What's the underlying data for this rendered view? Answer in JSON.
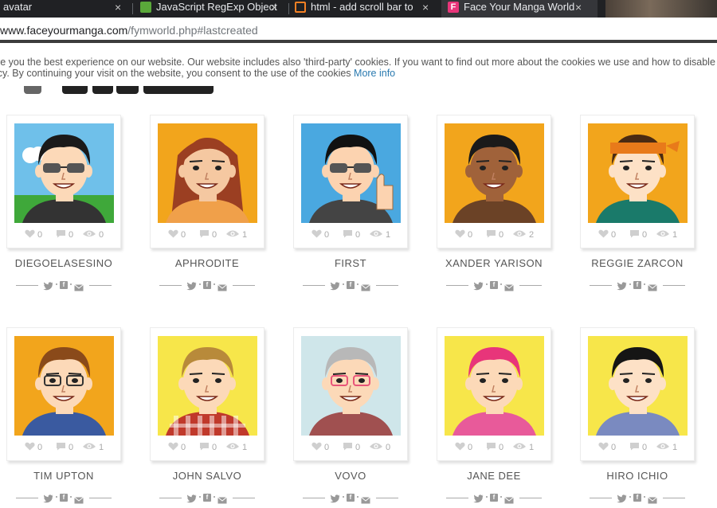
{
  "browser": {
    "tabs": [
      {
        "title": "avatar",
        "close": "×"
      },
      {
        "title": "JavaScript RegExp Object",
        "close": "×"
      },
      {
        "title": "html - add scroll bar to t",
        "close": "×"
      },
      {
        "title": "Face Your Manga World",
        "close": "×"
      }
    ],
    "url": {
      "host": "www.faceyourmanga.com",
      "path": "/fymworld.php#lastcreated"
    }
  },
  "cookie_notice": {
    "line1": "ve you the best experience on our website. Our website includes also 'third-party' cookies. If you want to find out more about the cookies we use and how to disable",
    "line2": "icy. By continuing your visit on the website, you consent to the use of the cookies",
    "link": "More info"
  },
  "cards": [
    {
      "name": "DIEGOELASESINO",
      "likes": "0",
      "comments": "0",
      "views": "0",
      "bg": "#6fc0ea",
      "skin": "#fcd9b8",
      "hair": "#1a1a1a",
      "glasses": "sun",
      "shirt": "#333333",
      "extra": "grass"
    },
    {
      "name": "APHRODITE",
      "likes": "0",
      "comments": "0",
      "views": "1",
      "bg": "#f2a51c",
      "skin": "#f5c8a1",
      "hair": "#9b3f22",
      "glasses": "none",
      "shirt": "#f0a04a",
      "extra": "longhair"
    },
    {
      "name": "FIRST",
      "likes": "0",
      "comments": "0",
      "views": "1",
      "bg": "#4aa8e0",
      "skin": "#fcd3b0",
      "hair": "#111111",
      "glasses": "sun",
      "shirt": "#444444",
      "extra": "thumb"
    },
    {
      "name": "XANDER YARISON",
      "likes": "0",
      "comments": "0",
      "views": "2",
      "bg": "#f2a51c",
      "skin": "#a0623a",
      "hair": "#1a1a1a",
      "glasses": "none",
      "shirt": "#6b4226",
      "extra": "none"
    },
    {
      "name": "REGGIE ZARCON",
      "likes": "0",
      "comments": "0",
      "views": "1",
      "bg": "#f2a51c",
      "skin": "#fde1c6",
      "hair": "#4a2a12",
      "glasses": "none",
      "shirt": "#1a7a6a",
      "extra": "bandana"
    },
    {
      "name": "TIM UPTON",
      "likes": "0",
      "comments": "0",
      "views": "1",
      "bg": "#f2a51c",
      "skin": "#fcd9b8",
      "hair": "#8a4a1a",
      "glasses": "clear",
      "shirt": "#3a5aa0",
      "extra": "none"
    },
    {
      "name": "JOHN SALVO",
      "likes": "0",
      "comments": "0",
      "views": "1",
      "bg": "#f7e64a",
      "skin": "#fcd9b8",
      "hair": "#b88a3a",
      "glasses": "none",
      "shirt": "#c0392b",
      "extra": "plaid"
    },
    {
      "name": "VOVO",
      "likes": "0",
      "comments": "0",
      "views": "0",
      "bg": "#cfe6ea",
      "skin": "#fcd9b8",
      "hair": "#b8b8b8",
      "glasses": "pink",
      "shirt": "#a05050",
      "extra": "none"
    },
    {
      "name": "JANE DEE",
      "likes": "0",
      "comments": "0",
      "views": "1",
      "bg": "#f7e64a",
      "skin": "#fcd9b8",
      "hair": "#e8357a",
      "glasses": "none",
      "shirt": "#e85a9a",
      "extra": "none"
    },
    {
      "name": "HIRO ICHIO",
      "likes": "0",
      "comments": "0",
      "views": "1",
      "bg": "#f7e64a",
      "skin": "#fde1c6",
      "hair": "#151515",
      "glasses": "none",
      "shirt": "#7a8ac0",
      "extra": "none"
    }
  ]
}
